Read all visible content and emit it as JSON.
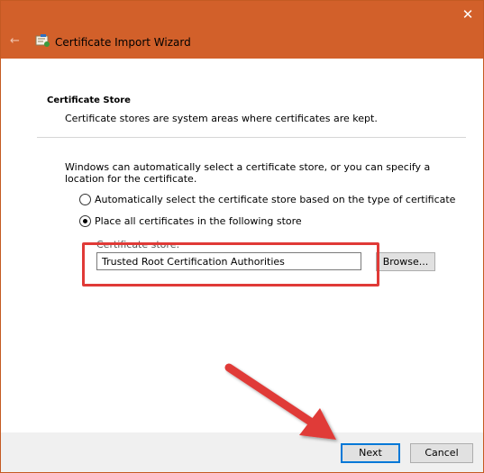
{
  "window": {
    "title": "Certificate Import Wizard"
  },
  "icons": {
    "close": "close-icon",
    "back": "back-arrow-icon",
    "app": "certificate-icon"
  },
  "section": {
    "title": "Certificate Store",
    "description": "Certificate stores are system areas where certificates are kept."
  },
  "intro": "Windows can automatically select a certificate store, or you can specify a location for the certificate.",
  "options": [
    {
      "label": "Automatically select the certificate store based on the type of certificate",
      "selected": false
    },
    {
      "label": "Place all certificates in the following store",
      "selected": true
    }
  ],
  "store": {
    "label": "Certificate store:",
    "value": "Trusted Root Certification Authorities",
    "browse_label": "Browse..."
  },
  "footer": {
    "next_label": "Next",
    "cancel_label": "Cancel"
  },
  "colors": {
    "titlebar": "#d2602a",
    "annotation": "#e03a37",
    "focus": "#0078d7"
  }
}
